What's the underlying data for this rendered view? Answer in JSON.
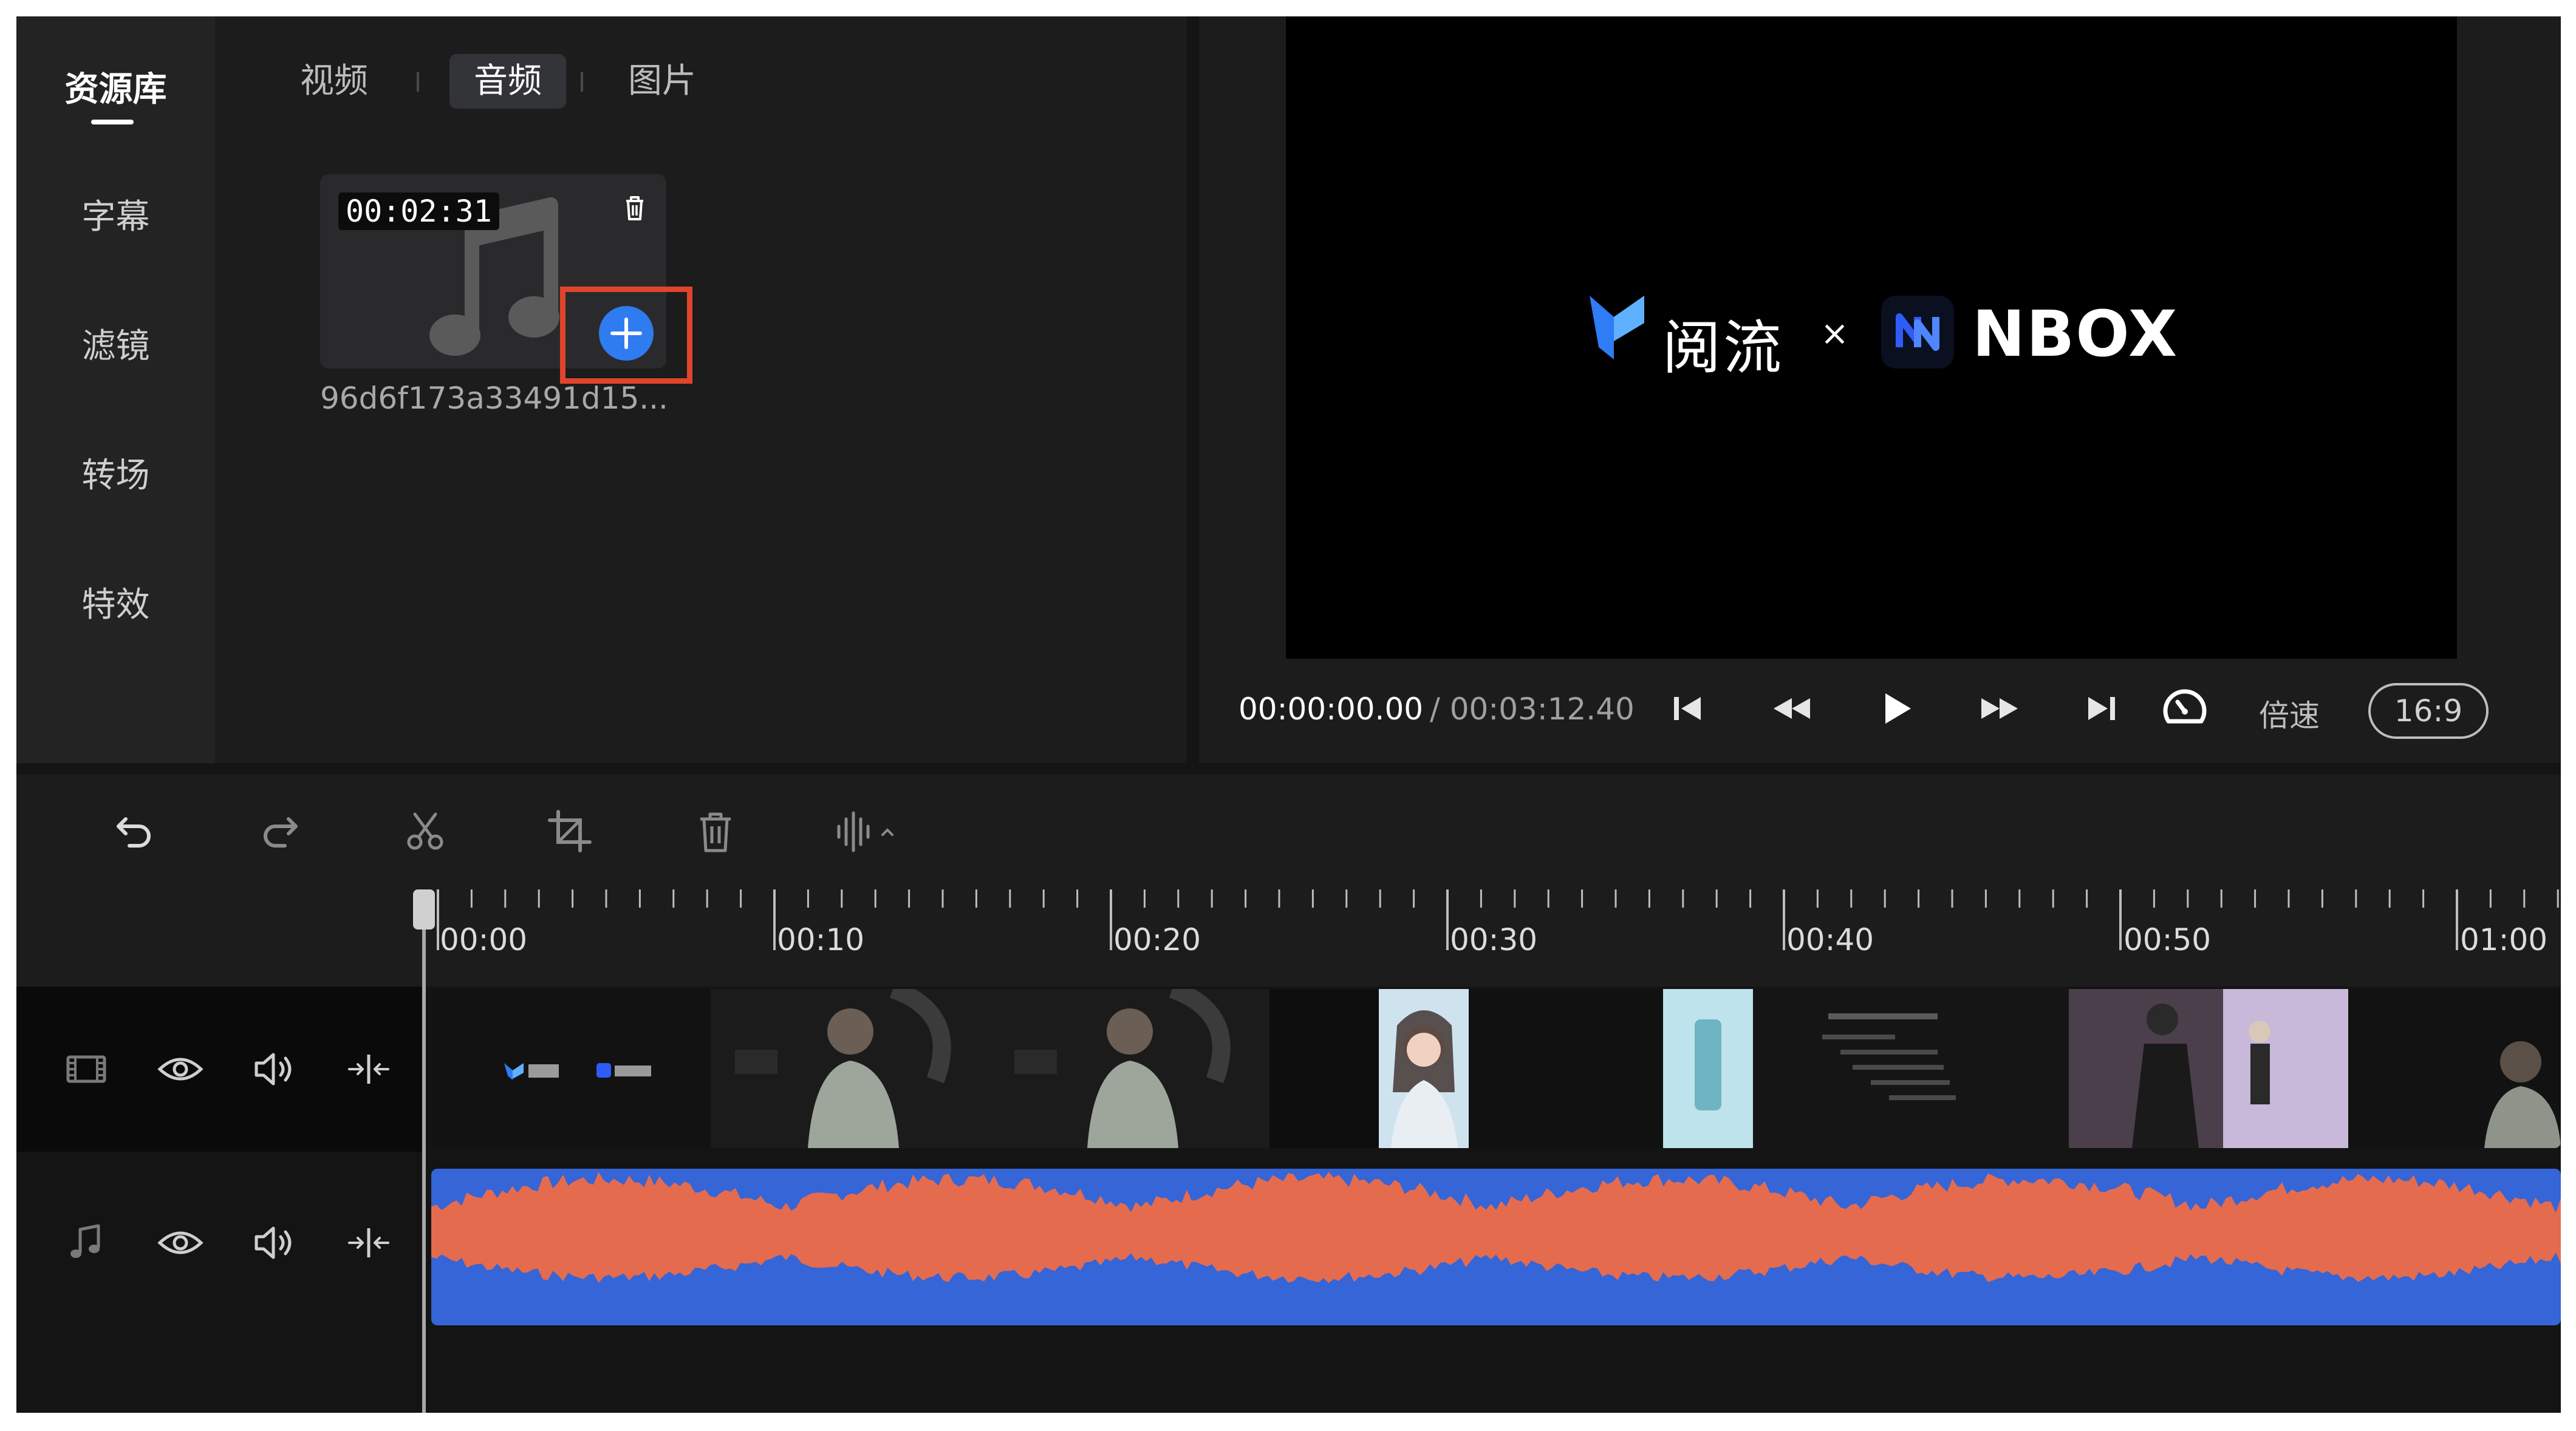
{
  "left_nav": {
    "items": [
      {
        "label": "资源库",
        "active": true
      },
      {
        "label": "字幕",
        "active": false
      },
      {
        "label": "滤镜",
        "active": false
      },
      {
        "label": "转场",
        "active": false
      },
      {
        "label": "特效",
        "active": false
      }
    ]
  },
  "library": {
    "tabs": [
      {
        "label": "视频",
        "active": false
      },
      {
        "label": "音频",
        "active": true
      },
      {
        "label": "图片",
        "active": false
      }
    ],
    "item": {
      "duration": "00:02:31",
      "name": "96d6f173a33491d15...",
      "icon": "music-note-icon"
    }
  },
  "preview": {
    "logo_cn": "阅流",
    "logo_x": "×",
    "logo_nbox": "NBOX",
    "current_time": "00:00:00.00",
    "total_time": "/ 00:03:12.40",
    "speed_label": "倍速",
    "aspect_ratio": "16:9"
  },
  "timeline": {
    "ticks": [
      "00:00",
      "00:10",
      "00:20",
      "00:30",
      "00:40",
      "00:50",
      "01:00"
    ]
  },
  "colors": {
    "accent_blue": "#2f7bf0",
    "highlight_red": "#e0452c",
    "audio_track": "#3565d6",
    "waveform": "#e56b4f"
  }
}
